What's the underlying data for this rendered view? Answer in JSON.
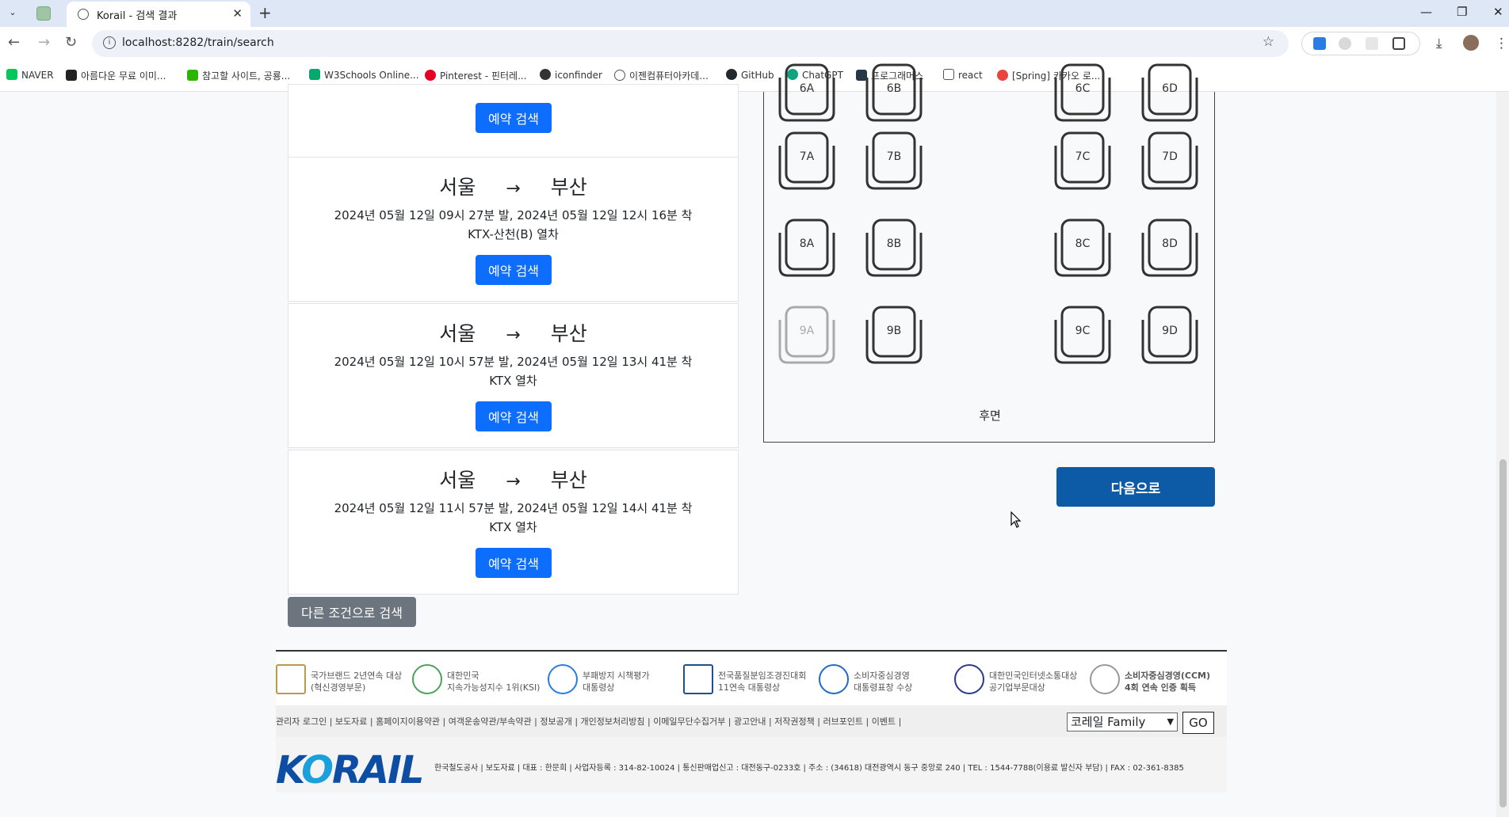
{
  "browser": {
    "tab_title": "Korail - 검색 결과",
    "url": "localhost:8282/train/search",
    "bookmarks": [
      {
        "label": "NAVER",
        "color": "#03c75a"
      },
      {
        "label": "아름다운 무료 이미...",
        "color": "#222222"
      },
      {
        "label": "참고할 사이트, 공룡...",
        "color": "#2db400"
      },
      {
        "label": "W3Schools Online...",
        "color": "#04aa6d"
      },
      {
        "label": "Pinterest - 핀터레...",
        "color": "#e60023"
      },
      {
        "label": "iconfinder",
        "color": "#333333"
      },
      {
        "label": "이젠컴퓨터아카데...",
        "color": "#555555"
      },
      {
        "label": "GitHub",
        "color": "#24292e"
      },
      {
        "label": "ChatGPT",
        "color": "#10a37f"
      },
      {
        "label": "프로그래머스",
        "color": "#263747"
      },
      {
        "label": "react",
        "color": "#666666"
      },
      {
        "label": "[Spring] 카카오 로...",
        "color": "#e8453c"
      }
    ]
  },
  "results": [
    {
      "from": "서울",
      "arrow": "→",
      "to": "부산",
      "times": "2024년 05월 12일 09시 27분 발, 2024년 05월 12일 12시 16분 착",
      "train": "KTX-산천(B) 열차",
      "button": "예약 검색"
    },
    {
      "from": "서울",
      "arrow": "→",
      "to": "부산",
      "times": "2024년 05월 12일 10시 57분 발, 2024년 05월 12일 13시 41분 착",
      "train": "KTX 열차",
      "button": "예약 검색"
    },
    {
      "from": "서울",
      "arrow": "→",
      "to": "부산",
      "times": "2024년 05월 12일 11시 57분 발, 2024년 05월 12일 14시 41분 착",
      "train": "KTX 열차",
      "button": "예약 검색"
    }
  ],
  "top_partial_button": "예약 검색",
  "other_search_button": "다른 조건으로 검색",
  "seats": {
    "rows": [
      {
        "row": "6",
        "seats": [
          {
            "id": "6A",
            "available": true
          },
          {
            "id": "6B",
            "available": true
          },
          {
            "id": "6C",
            "available": true
          },
          {
            "id": "6D",
            "available": true
          }
        ]
      },
      {
        "row": "7",
        "seats": [
          {
            "id": "7A",
            "available": true
          },
          {
            "id": "7B",
            "available": true
          },
          {
            "id": "7C",
            "available": true
          },
          {
            "id": "7D",
            "available": true
          }
        ]
      },
      {
        "row": "8",
        "seats": [
          {
            "id": "8A",
            "available": true
          },
          {
            "id": "8B",
            "available": true
          },
          {
            "id": "8C",
            "available": true
          },
          {
            "id": "8D",
            "available": true
          }
        ]
      },
      {
        "row": "9",
        "seats": [
          {
            "id": "9A",
            "available": false
          },
          {
            "id": "9B",
            "available": true
          },
          {
            "id": "9C",
            "available": true
          },
          {
            "id": "9D",
            "available": true
          }
        ]
      }
    ],
    "rear_label": "후면"
  },
  "next_button": "다음으로",
  "footer": {
    "awards": [
      {
        "line1": "국가브랜드 2년연속 대상",
        "line2": "(혁신경영부문)"
      },
      {
        "line1": "대한민국",
        "line2": "지속가능성지수 1위(KSI)"
      },
      {
        "line1": "부패방지 시책평가",
        "line2": "대통령상"
      },
      {
        "line1": "전국품질분임조경진대회",
        "line2": "11연속 대통령상"
      },
      {
        "line1": "소비자중심경영",
        "line2": "대통령표창 수상"
      },
      {
        "line1": "대한민국인터넷소통대상",
        "line2": "공기업부문대상"
      },
      {
        "line1": "소비자중심경영(CCM)",
        "line2": "4회 연속 인증 획득"
      }
    ],
    "links": "관리자 로그인 | 보도자료 | 홈페이지이용약관 | 여객운송약관/부속약관 | 정보공개 | 개인정보처리방침 | 이메일무단수집거부 | 광고안내 | 저작권정책 | 러브포인트 | 이벤트 |",
    "family_select": "코레일 Family",
    "go_button": "GO",
    "logo_text": {
      "k": "K",
      "o": "O",
      "rest": "RAIL"
    },
    "corp_info": "한국철도공사 | 보도자료 | 대표 : 한문희 | 사업자등록 : 314-82-10024 | 통신판매업신고 : 대전동구-0233호 | 주소 : (34618) 대전광역시 동구 중앙로 240 | TEL : 1544-7788(이용료 발신자 부담) | FAX : 02-361-8385"
  }
}
